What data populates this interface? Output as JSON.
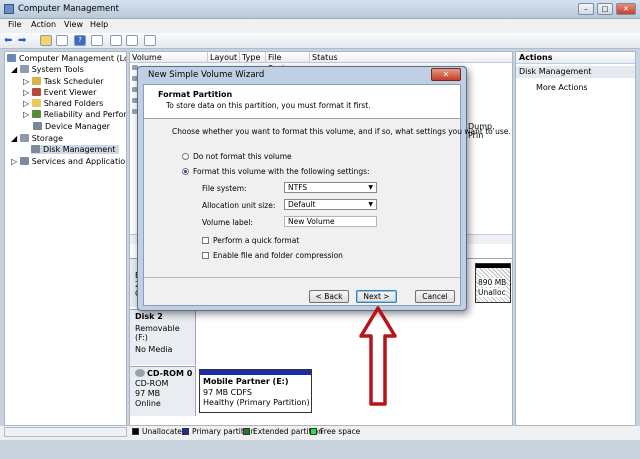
{
  "window": {
    "title": "Computer Management",
    "min": "–",
    "max": "□",
    "close": "✕"
  },
  "menu": [
    "File",
    "Action",
    "View",
    "Help"
  ],
  "tree": {
    "root": "Computer Management (Local",
    "system_tools": "System Tools",
    "task_scheduler": "Task Scheduler",
    "event_viewer": "Event Viewer",
    "shared_folders": "Shared Folders",
    "reliability": "Reliability and Performa",
    "device_manager": "Device Manager",
    "storage": "Storage",
    "disk_management": "Disk Management",
    "services": "Services and Applications"
  },
  "columns": [
    "Volume",
    "Layout",
    "Type",
    "File System",
    "Status"
  ],
  "status_fragment": "Dump, Prin",
  "actions": {
    "header": "Actions",
    "section": "Disk Management",
    "more": "More Actions"
  },
  "disks": {
    "disk1": {
      "partial_label": "B",
      "partial_size": "2",
      "partial_state": "O",
      "unalloc_size": "890 MB",
      "unalloc_label": "Unalloc"
    },
    "disk2": {
      "title": "Disk 2",
      "type": "Removable (F:)",
      "media": "No Media"
    },
    "cdrom": {
      "title": "CD-ROM 0",
      "type": "CD-ROM",
      "size": "97 MB",
      "status": "Online",
      "vol_name": "Mobile Partner  (E:)",
      "vol_fs": "97 MB CDFS",
      "vol_health": "Healthy (Primary Partition)"
    }
  },
  "legend": [
    {
      "label": "Unallocated",
      "color": "#000000"
    },
    {
      "label": "Primary partition",
      "color": "#1a2ea8"
    },
    {
      "label": "Extended partition",
      "color": "#1f7a2a"
    },
    {
      "label": "Free space",
      "color": "#2ee03a"
    }
  ],
  "dialog": {
    "title": "New Simple Volume Wizard",
    "close": "✕",
    "heading": "Format Partition",
    "subheading": "To store data on this partition, you must format it first.",
    "instruction": "Choose whether you want to format this volume, and if so, what settings you want to use.",
    "radio_no": "Do not format this volume",
    "radio_yes": "Format this volume with the following settings:",
    "fs_label": "File system:",
    "fs_value": "NTFS",
    "alloc_label": "Allocation unit size:",
    "alloc_value": "Default",
    "vol_label": "Volume label:",
    "vol_value": "New Volume",
    "quick_format": "Perform a quick format",
    "compression": "Enable file and folder compression",
    "back": "< Back",
    "next": "Next >",
    "cancel": "Cancel"
  },
  "colors": {
    "arrow": "#b8121b",
    "titlebar": "#c9d6e6"
  }
}
